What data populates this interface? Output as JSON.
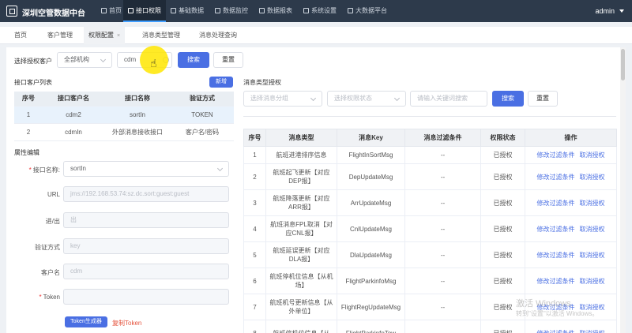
{
  "header": {
    "title": "深圳空管数据中台",
    "nav": [
      {
        "label": "首页",
        "icon": "home-icon"
      },
      {
        "label": "接口权限",
        "icon": "key-icon",
        "active": true
      },
      {
        "label": "基础数据",
        "icon": "gear-icon"
      },
      {
        "label": "数据监控",
        "icon": "monitor-icon"
      },
      {
        "label": "数据报表",
        "icon": "report-icon"
      },
      {
        "label": "系统设置",
        "icon": "settings-icon"
      },
      {
        "label": "大数据平台",
        "icon": "platform-icon"
      }
    ],
    "user": "admin"
  },
  "tabs": [
    {
      "label": "首页"
    },
    {
      "label": "客户管理"
    },
    {
      "label": "权限配置",
      "active": true,
      "close": "×"
    },
    {
      "label": "消息类型管理"
    },
    {
      "label": "消息处理查询"
    }
  ],
  "filter": {
    "label": "选择授权客户",
    "org_value": "全部机构",
    "client_value": "cdm",
    "search": "搜索",
    "reset": "重置"
  },
  "client_list": {
    "title": "接口客户列表",
    "add": "新增",
    "headers": [
      "序号",
      "接口客户名",
      "接口名称",
      "验证方式"
    ],
    "rows": [
      [
        "1",
        "cdm2",
        "sortIn",
        "TOKEN"
      ],
      [
        "2",
        "cdmIn",
        "外部消息接收接口",
        "客户名/密码"
      ]
    ]
  },
  "attrs": {
    "title": "属性编辑",
    "iface_label": "接口名称:",
    "iface_value": "sortIn",
    "url_label": "URL",
    "url_value": "jms://192.168.53.74:sz.dc.sort:guest:guest",
    "io_label": "进/出",
    "io_value": "出",
    "auth_label": "验证方式",
    "auth_value": "key",
    "client_label": "客户名",
    "client_value": "cdm",
    "token_label": "Token",
    "token_btn": "Token生成器",
    "copy_token": "复制Token"
  },
  "msg_auth": {
    "title": "消息类型授权",
    "group_ph": "选择消息分组",
    "state_ph": "选择权限状态",
    "keyword_ph": "请输入关键词搜索",
    "search": "搜索",
    "reset": "重置",
    "headers": [
      "序号",
      "消息类型",
      "消息Key",
      "消息过滤条件",
      "权限状态",
      "操作"
    ],
    "rows": [
      [
        "1",
        "航班进港排序信息",
        "FlightInSortMsg",
        "--",
        "已授权"
      ],
      [
        "2",
        "航班起飞更新【对应DEP报】",
        "DepUpdateMsg",
        "--",
        "已授权"
      ],
      [
        "3",
        "航班降落更新【对应ARR报】",
        "ArrUpdateMsg",
        "--",
        "已授权"
      ],
      [
        "4",
        "航班消息FPL取消【对应CNL报】",
        "CnlUpdateMsg",
        "--",
        "已授权"
      ],
      [
        "5",
        "航班延误更新【对应DLA报】",
        "DlaUpdateMsg",
        "--",
        "已授权"
      ],
      [
        "6",
        "航班停机位信息【从机场】",
        "FlightParkinfoMsg",
        "--",
        "已授权"
      ],
      [
        "7",
        "航班机号更新信息【从外单位】",
        "FlightRegUpdateMsg",
        "--",
        "已授权"
      ],
      [
        "8",
        "航班停机位信息【从",
        "FlightParkinfoTow",
        "--",
        "已授权"
      ]
    ],
    "op_edit": "修改过滤条件",
    "op_cancel": "取消授权"
  },
  "watermark": {
    "line1": "激活 Windows",
    "line2": "转到\"设置\"以激活 Windows。"
  },
  "colors": {
    "accent": "#4a6fe3",
    "nav_bg": "#2d3a4b",
    "danger": "#e5533d"
  }
}
